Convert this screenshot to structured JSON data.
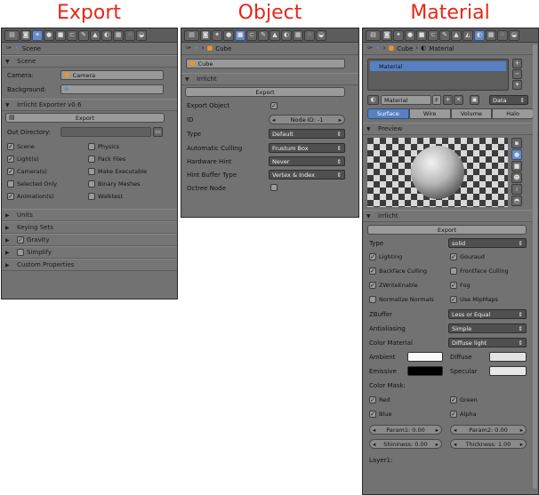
{
  "titles": {
    "export": "Export",
    "object": "Object",
    "material": "Material"
  },
  "colors": {
    "title": "#e82616",
    "panel": "#727272",
    "accent": "#5680c2"
  },
  "export": {
    "crumb": "Scene",
    "scene_header": "Scene",
    "camera_label": "Camera:",
    "camera_value": "Camera",
    "background_label": "Background:",
    "irr_header": "Irrlicht Exporter v0.6",
    "export_btn": "Export",
    "outdir_label": "Out Directory:",
    "checks": [
      {
        "label": "Scene",
        "checked": true
      },
      {
        "label": "Physics",
        "checked": false
      },
      {
        "label": "Light(s)",
        "checked": true
      },
      {
        "label": "Pack Files",
        "checked": false
      },
      {
        "label": "Camera(s)",
        "checked": true
      },
      {
        "label": "Make Executable",
        "checked": false
      },
      {
        "label": "Selected Only",
        "checked": false
      },
      {
        "label": "Binary Meshes",
        "checked": false
      },
      {
        "label": "Animation(s)",
        "checked": true
      },
      {
        "label": "Walktest",
        "checked": false
      }
    ],
    "sections": [
      "Units",
      "Keying Sets",
      "Gravity",
      "Simplify",
      "Custom Properties"
    ]
  },
  "object": {
    "crumb": "Cube",
    "name_value": "Cube",
    "irr_header": "Irrlicht",
    "export_btn": "Export",
    "export_object_label": "Export Object",
    "id_label": "ID",
    "id_value": "Node ID: -1",
    "type_label": "Type",
    "type_value": "Default",
    "culling_label": "Automatic Culling",
    "culling_value": "Frustum Box",
    "hint_label": "Hardware Hint",
    "hint_value": "Never",
    "buffer_label": "Hint Buffer Type",
    "buffer_value": "Vertex & Index",
    "octree_label": "Octree Node"
  },
  "material": {
    "crumb_object": "Cube",
    "crumb_material": "Material",
    "slot_name": "Material",
    "mat_name": "Material",
    "mat_f": "F",
    "data_value": "Data",
    "tabs": [
      "Surface",
      "Wire",
      "Volume",
      "Halo"
    ],
    "preview_header": "Preview",
    "irr_header": "Irrlicht",
    "export_btn": "Export",
    "type_label": "Type",
    "type_value": "solid",
    "checks": [
      {
        "label": "Lighting",
        "checked": true
      },
      {
        "label": "Gouraud",
        "checked": true
      },
      {
        "label": "Backface Culling",
        "checked": true
      },
      {
        "label": "Frontface Culling",
        "checked": false
      },
      {
        "label": "ZWriteEnable",
        "checked": true
      },
      {
        "label": "Fog",
        "checked": true
      },
      {
        "label": "Normalize Normals",
        "checked": false
      },
      {
        "label": "Use MipMaps",
        "checked": true
      }
    ],
    "zbuffer_label": "ZBuffer",
    "zbuffer_value": "Less or Equal",
    "aa_label": "Antialiasing",
    "aa_value": "Simple",
    "cm_label": "Color Material",
    "cm_value": "Diffuse light",
    "ambient_label": "Ambient",
    "diffuse_label": "Diffuse",
    "emissive_label": "Emissive",
    "specular_label": "Specular",
    "colormask_label": "Color Mask:",
    "mask": [
      {
        "label": "Red",
        "checked": true
      },
      {
        "label": "Green",
        "checked": true
      },
      {
        "label": "Blue",
        "checked": true
      },
      {
        "label": "Alpha",
        "checked": true
      }
    ],
    "param1": "Param1: 0.00",
    "param2": "Param2: 0.00",
    "shininess": "Shininess: 0.00",
    "thickness": "Thickness: 1.00",
    "layer_label": "Layer1:"
  }
}
